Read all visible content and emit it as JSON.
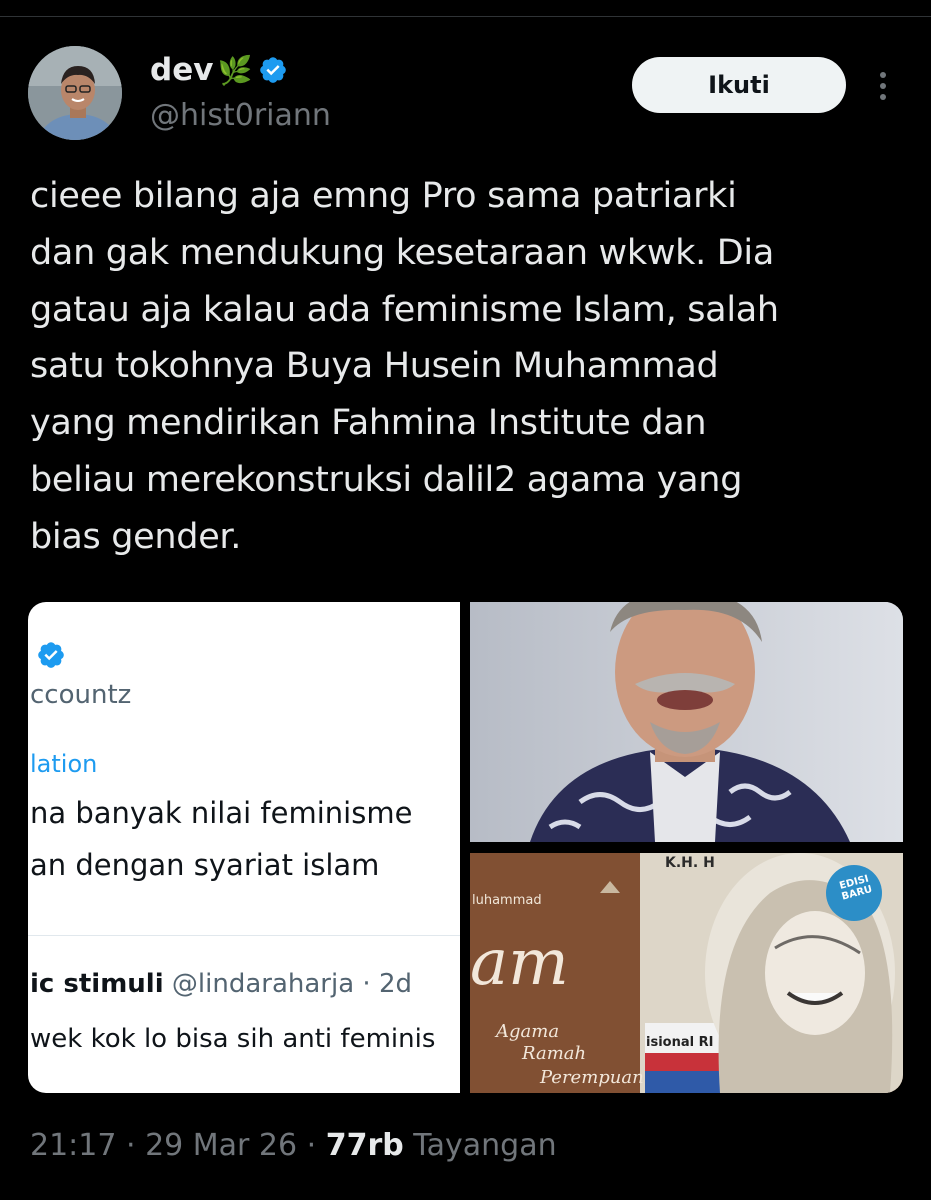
{
  "colors": {
    "background": "#000000",
    "text": "#e7e9ea",
    "muted": "#71767b",
    "verified": "#1d9bf0",
    "follow_bg": "#eff3f4"
  },
  "author": {
    "display_name": "dev",
    "leaf_emoji": "🌿",
    "handle": "@hist0riann",
    "verified_icon": "verified-badge-icon"
  },
  "actions": {
    "follow_label": "Ikuti",
    "more_icon": "more-vertical-icon"
  },
  "tweet": {
    "lines": [
      "cieee bilang aja emng Pro sama patriarki",
      "dan gak mendukung kesetaraan wkwk. Dia",
      "gatau aja kalau ada feminisme Islam, salah",
      "satu tokohnya Buya Husein Muhammad",
      "yang mendirikan Fahmina Institute dan",
      "beliau merekonstruksi dalil2 agama yang",
      "bias gender."
    ]
  },
  "media": {
    "screenshot": {
      "handle_fragment": "ccountz",
      "translate_fragment": "lation",
      "line1": "na banyak nilai feminisme ",
      "line2": "an dengan syariat islam",
      "reply_name": "ic stimuli",
      "reply_handle": "@lindaraharja",
      "reply_sep": " · ",
      "reply_time": "2d",
      "reply_text": "wek kok lo bisa sih anti feminis"
    },
    "book": {
      "author_fragment": "luhammad",
      "title_fragment": "am",
      "subtitle_line1": "Agama",
      "subtitle_line2": "Ramah",
      "subtitle_line3": "Perempuan",
      "top_label": "K.H. H",
      "badge_line1": "EDISI",
      "badge_line2": "BARU",
      "side_label": "isional RI"
    }
  },
  "footer": {
    "time": "21:17",
    "sep": " · ",
    "date": "29 Mar 26",
    "views_count": "77rb",
    "views_label": " Tayangan"
  }
}
